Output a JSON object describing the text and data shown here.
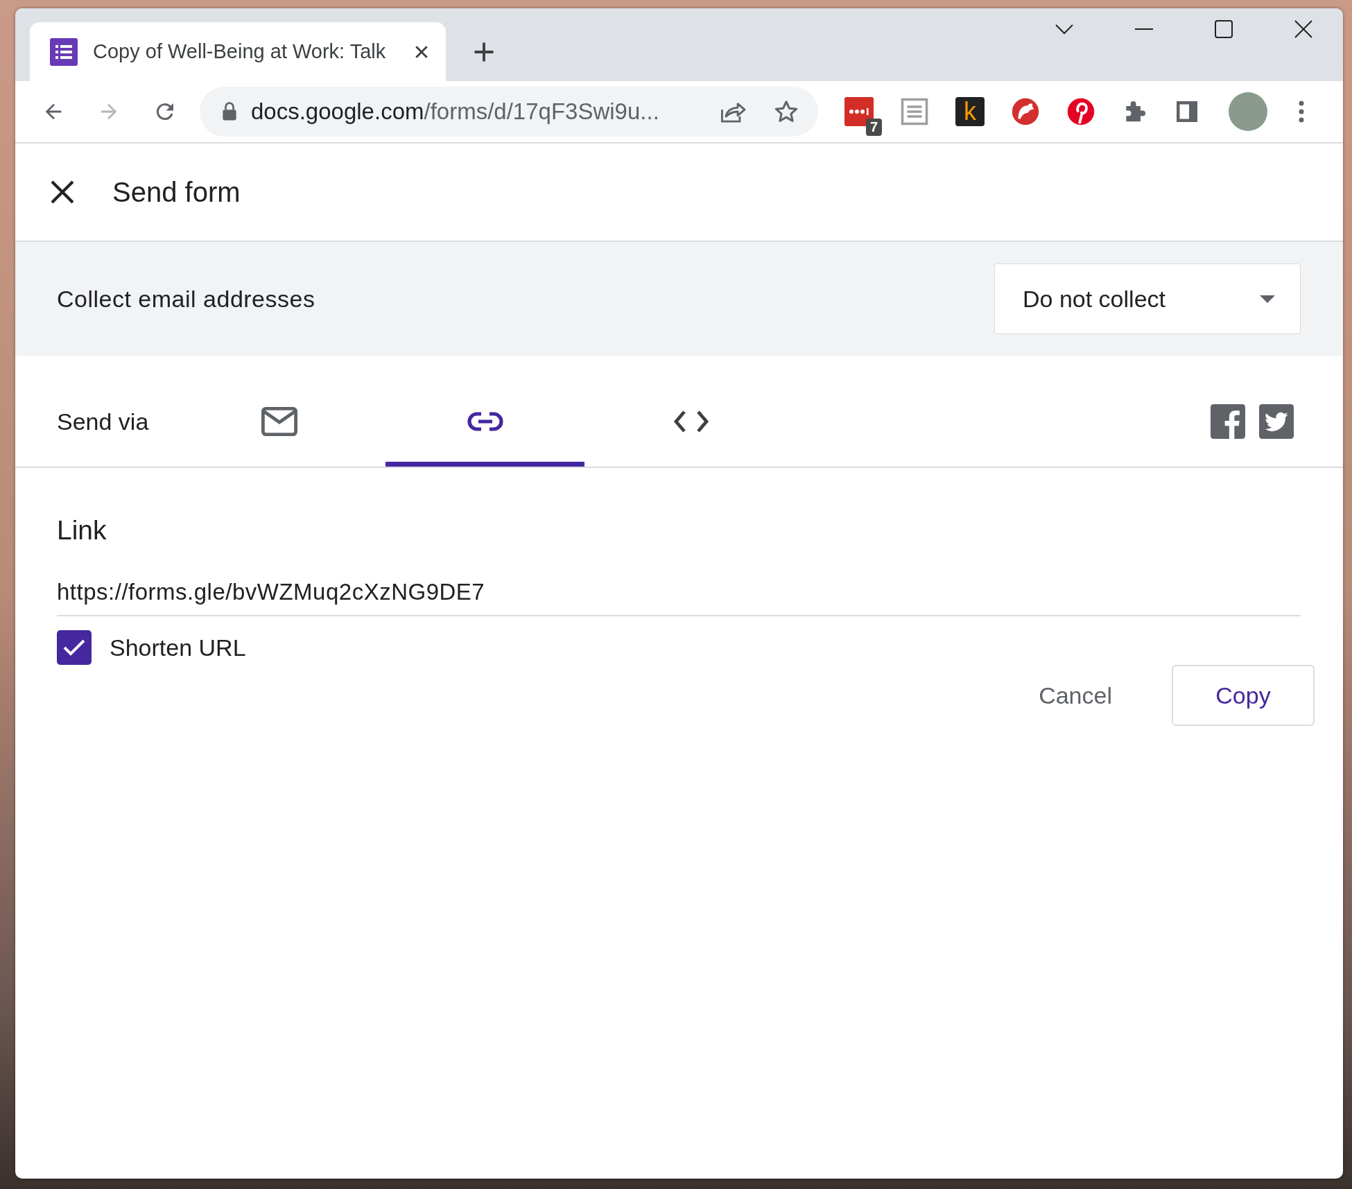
{
  "browser": {
    "tab": {
      "title": "Copy of Well-Being at Work: Talk",
      "selected": true
    },
    "address_bar": {
      "domain": "docs.google.com",
      "path": "/forms/d/17qF3Swi9u..."
    },
    "extensions": [
      {
        "kind": "password",
        "badge": "7"
      },
      {
        "kind": "reader"
      },
      {
        "kind": "letter",
        "text": "k"
      },
      {
        "kind": "bear"
      },
      {
        "kind": "pinterest"
      },
      {
        "kind": "puzzle"
      },
      {
        "kind": "sidepanel"
      }
    ]
  },
  "dialog": {
    "title": "Send form",
    "collect_email": {
      "label": "Collect email addresses",
      "value": "Do not collect"
    },
    "send_via": {
      "label": "Send via",
      "tabs": [
        {
          "kind": "email",
          "selected": false
        },
        {
          "kind": "link",
          "selected": true
        },
        {
          "kind": "embed",
          "selected": false
        }
      ]
    },
    "link": {
      "heading": "Link",
      "url": "https://forms.gle/bvWZMuq2cXzNG9DE7",
      "shorten_url": {
        "label": "Shorten URL",
        "checked": true
      }
    },
    "buttons": [
      {
        "label": "Cancel",
        "kind": "text"
      },
      {
        "label": "Copy",
        "kind": "outlined"
      }
    ]
  }
}
